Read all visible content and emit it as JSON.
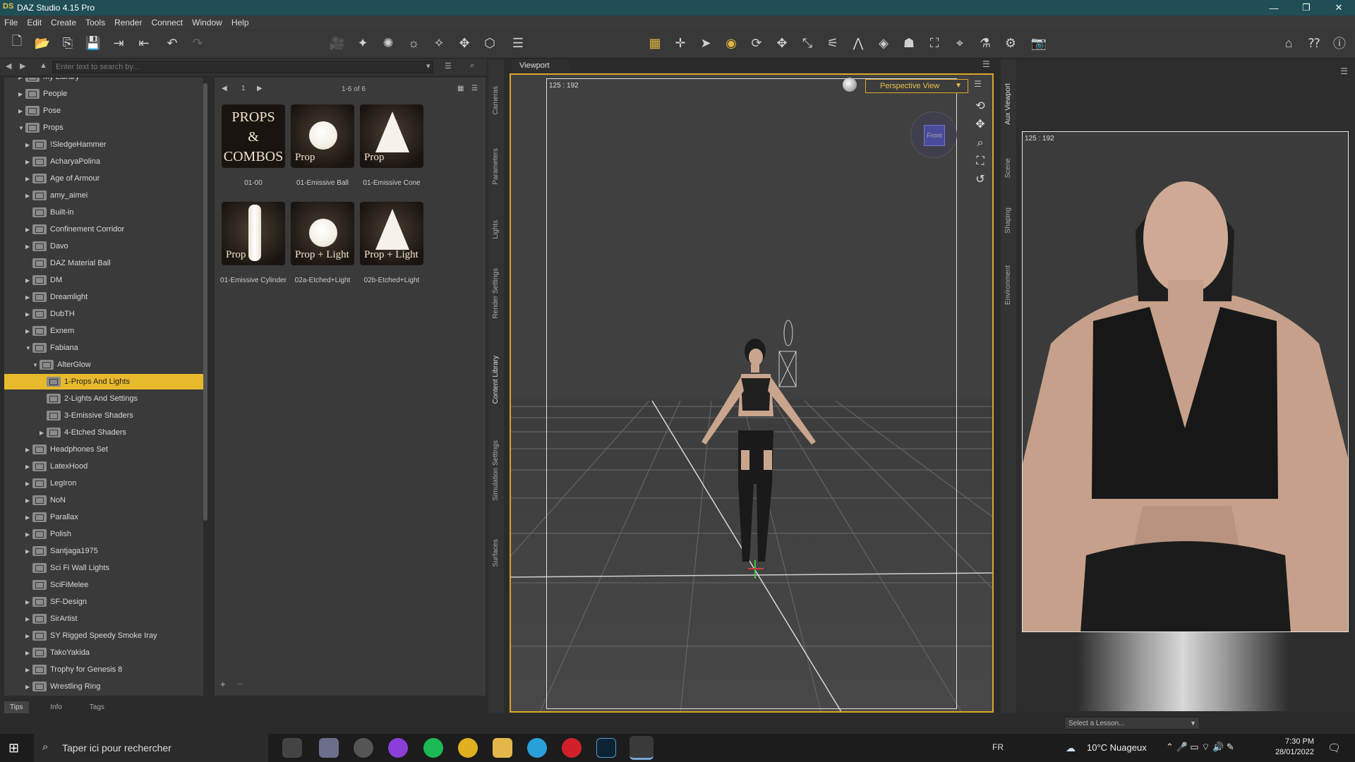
{
  "window": {
    "title": "DAZ Studio 4.15 Pro",
    "logo": "DS",
    "controls": [
      "—",
      "❐",
      "✕"
    ]
  },
  "menu": [
    "File",
    "Edit",
    "Create",
    "Tools",
    "Render",
    "Connect",
    "Window",
    "Help"
  ],
  "search": {
    "placeholder": "Enter text to search by..."
  },
  "tree": {
    "items": [
      {
        "label": "My Library",
        "indent": 0,
        "arrow": "▶"
      },
      {
        "label": "People",
        "indent": 0,
        "arrow": "▶"
      },
      {
        "label": "Pose",
        "indent": 0,
        "arrow": "▶"
      },
      {
        "label": "Props",
        "indent": 0,
        "arrow": "▼"
      },
      {
        "label": "!SledgeHammer",
        "indent": 1,
        "arrow": "▶"
      },
      {
        "label": "AcharyaPolina",
        "indent": 1,
        "arrow": "▶"
      },
      {
        "label": "Age of Armour",
        "indent": 1,
        "arrow": "▶"
      },
      {
        "label": "amy_aimei",
        "indent": 1,
        "arrow": "▶"
      },
      {
        "label": "Built-in",
        "indent": 1,
        "arrow": ""
      },
      {
        "label": "Confinement Corridor",
        "indent": 1,
        "arrow": "▶"
      },
      {
        "label": "Davo",
        "indent": 1,
        "arrow": "▶"
      },
      {
        "label": "DAZ Material Ball",
        "indent": 1,
        "arrow": ""
      },
      {
        "label": "DM",
        "indent": 1,
        "arrow": "▶"
      },
      {
        "label": "Dreamlight",
        "indent": 1,
        "arrow": "▶"
      },
      {
        "label": "DubTH",
        "indent": 1,
        "arrow": "▶"
      },
      {
        "label": "Exnem",
        "indent": 1,
        "arrow": "▶"
      },
      {
        "label": "Fabiana",
        "indent": 1,
        "arrow": "▼"
      },
      {
        "label": "AlterGlow",
        "indent": 2,
        "arrow": "▼"
      },
      {
        "label": "1-Props And Lights",
        "indent": 3,
        "arrow": "",
        "selected": true
      },
      {
        "label": "2-Lights And Settings",
        "indent": 3,
        "arrow": ""
      },
      {
        "label": "3-Emissive Shaders",
        "indent": 3,
        "arrow": ""
      },
      {
        "label": "4-Etched Shaders",
        "indent": 3,
        "arrow": "▶"
      },
      {
        "label": "Headphones Set",
        "indent": 1,
        "arrow": "▶"
      },
      {
        "label": "LatexHood",
        "indent": 1,
        "arrow": "▶"
      },
      {
        "label": "LegIron",
        "indent": 1,
        "arrow": "▶"
      },
      {
        "label": "NoN",
        "indent": 1,
        "arrow": "▶"
      },
      {
        "label": "Parallax",
        "indent": 1,
        "arrow": "▶"
      },
      {
        "label": "Polish",
        "indent": 1,
        "arrow": "▶"
      },
      {
        "label": "Santjaga1975",
        "indent": 1,
        "arrow": "▶"
      },
      {
        "label": "Sci Fi Wall Lights",
        "indent": 1,
        "arrow": ""
      },
      {
        "label": "SciFiMelee",
        "indent": 1,
        "arrow": ""
      },
      {
        "label": "SF-Design",
        "indent": 1,
        "arrow": "▶"
      },
      {
        "label": "SirArtist",
        "indent": 1,
        "arrow": "▶"
      },
      {
        "label": "SY Rigged Speedy Smoke Iray",
        "indent": 1,
        "arrow": "▶"
      },
      {
        "label": "TakoYakida",
        "indent": 1,
        "arrow": "▶"
      },
      {
        "label": "Trophy for Genesis 8",
        "indent": 1,
        "arrow": "▶"
      },
      {
        "label": "Wrestling Ring",
        "indent": 1,
        "arrow": "▶"
      }
    ]
  },
  "content": {
    "page_nav": "1",
    "count": "1-6 of 6",
    "thumbs": [
      {
        "caption": "01-00",
        "kind": "combo",
        "t1": "PROPS",
        "t2": "&",
        "t3": "COMBOS"
      },
      {
        "caption": "01-Emissive Ball",
        "kind": "ball",
        "label": "Prop"
      },
      {
        "caption": "01-Emissive Cone",
        "kind": "cone",
        "label": "Prop"
      },
      {
        "caption": "01-Emissive Cylinder",
        "kind": "cyl",
        "label": "Prop"
      },
      {
        "caption": "02a-Etched+Light",
        "kind": "ball",
        "label": "Prop + Light"
      },
      {
        "caption": "02b-Etched+Light",
        "kind": "cone",
        "label": "Prop + Light"
      }
    ]
  },
  "bottom_tabs": [
    "Tips",
    "Info",
    "Tags"
  ],
  "side_tabs_left": [
    "Cameras",
    "Parameters",
    "Lights",
    "Render Settings",
    "Content Library",
    "Simulation Settings",
    "Surfaces"
  ],
  "side_tabs_right": [
    "Aux Viewport",
    "Scene",
    "Shaping",
    "Environment"
  ],
  "viewport": {
    "tab": "Viewport",
    "ratio": "125 : 192",
    "view": "Perspective View",
    "cube_face": "Front"
  },
  "aux": {
    "ratio": "125 : 192"
  },
  "lesson": {
    "placeholder": "Select a Lesson..."
  },
  "taskbar": {
    "search": "Taper ici pour rechercher",
    "lang": "FR",
    "weather": "10°C  Nuageux",
    "time": "7:30 PM",
    "date": "28/01/2022"
  },
  "colors": {
    "accent": "#e8b92c",
    "titlebar": "#1f4e57"
  }
}
